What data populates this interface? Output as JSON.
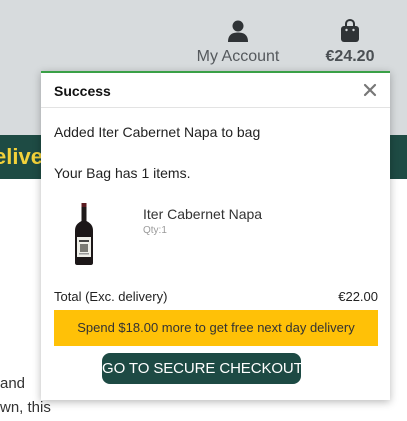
{
  "header": {
    "account_label": "My Account",
    "bag_total": "€24.20",
    "bg_color": "#d7dbdd",
    "account_icon": "user-icon",
    "bag_icon": "shopping-bag-icon"
  },
  "banner": {
    "text": "elive",
    "bg_color": "#1e4b44",
    "text_color": "#f3d23a"
  },
  "background_text": {
    "line1": "and",
    "line2": "wn, this"
  },
  "toast": {
    "title": "Success",
    "close_icon": "close-icon",
    "added_message": "Added Iter Cabernet Napa to bag",
    "bag_count_message": "Your Bag has 1 items.",
    "accent_color": "#3aa047",
    "product": {
      "name": "Iter Cabernet Napa",
      "qty": "Qty:1",
      "image": "wine-bottle-icon"
    },
    "total_label": "Total (Exc. delivery)",
    "total_value": "€22.00",
    "promo_text": "Spend $18.00 more to get free next day delivery",
    "promo_color": "#ffc107",
    "checkout_label": "GO TO SECURE CHECKOUT",
    "checkout_color": "#1d4a44"
  }
}
